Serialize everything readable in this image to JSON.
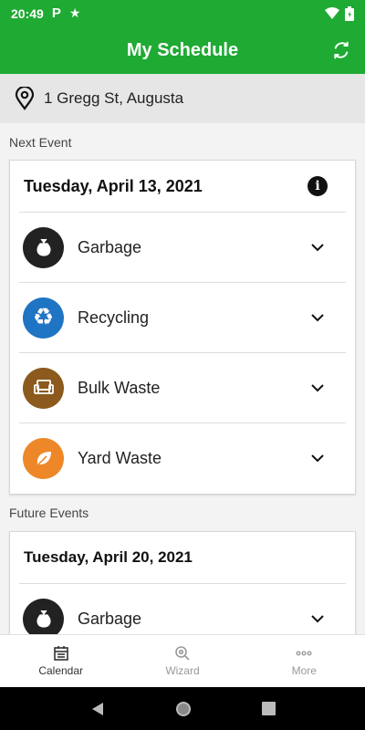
{
  "status_bar": {
    "time": "20:49"
  },
  "app_bar": {
    "title": "My Schedule"
  },
  "address": {
    "text": "1 Gregg St, Augusta"
  },
  "next_section": {
    "label": "Next Event",
    "date": "Tuesday, April 13, 2021",
    "events": [
      {
        "label": "Garbage",
        "color": "#222222",
        "icon": "garbage-bag-icon"
      },
      {
        "label": "Recycling",
        "color": "#1f74c3",
        "icon": "recycle-icon"
      },
      {
        "label": "Bulk Waste",
        "color": "#8b5a1c",
        "icon": "armchair-icon"
      },
      {
        "label": "Yard Waste",
        "color": "#ee8728",
        "icon": "leaf-icon"
      }
    ]
  },
  "future_section": {
    "label": "Future Events",
    "date": "Tuesday, April 20, 2021",
    "events": [
      {
        "label": "Garbage",
        "color": "#222222",
        "icon": "garbage-bag-icon"
      }
    ]
  },
  "bottom_nav": {
    "items": [
      {
        "label": "Calendar",
        "icon": "calendar-icon",
        "active": true
      },
      {
        "label": "Wizard",
        "icon": "magnifier-icon",
        "active": false
      },
      {
        "label": "More",
        "icon": "more-dots-icon",
        "active": false
      }
    ]
  },
  "theme": {
    "primary": "#1faa33"
  }
}
